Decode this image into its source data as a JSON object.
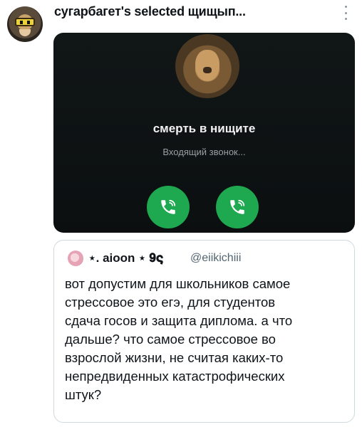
{
  "header": {
    "author": "сугарбагет's selected щищып..."
  },
  "media": {
    "caller_name": "смерть в нищите",
    "call_status": "Входящий звонок..."
  },
  "quote": {
    "name": "⋆. aioon ⋆ 𝟗𝛓",
    "handle": "@eiikichiii",
    "text": "вот допустим для школьников самое\nстрессовое это егэ, для студентов\nсдача госов и защита диплома. а что\nдальше? что самое стрессовое во\nвзрослой жизни, не считая каких-то\nнепредвиденных катастрофических\nштук?"
  },
  "colors": {
    "call_button": "#1ea84f",
    "media_background": "#111617",
    "handle": "#536471",
    "border": "#cfd9de"
  },
  "icons": [
    "more-icon",
    "phone-icon"
  ]
}
